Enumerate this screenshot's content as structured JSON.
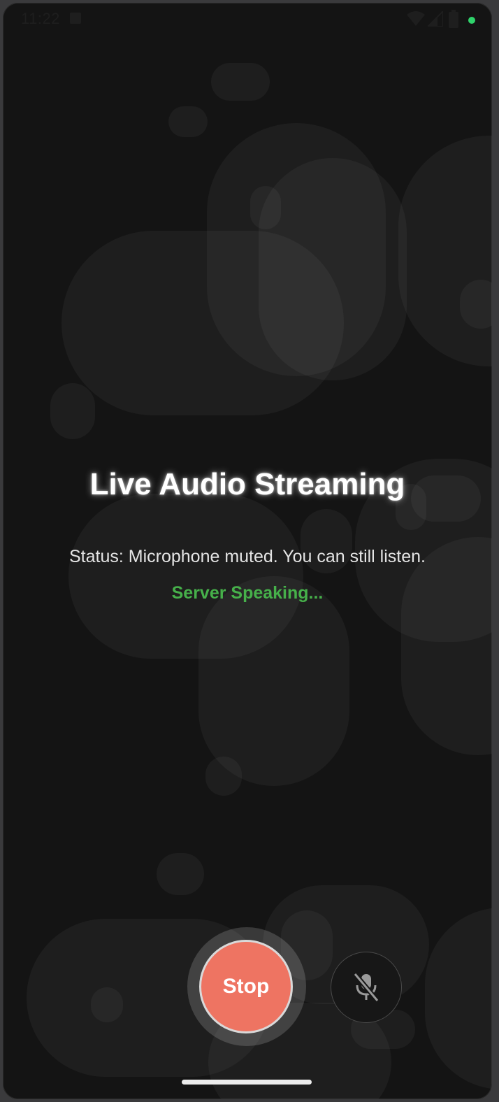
{
  "status_bar": {
    "time": "11:22",
    "icons": [
      "a-notification-icon",
      "wifi-icon",
      "signal-icon",
      "battery-icon",
      "green-dot-indicator"
    ],
    "indicator_color": "#2fd36b"
  },
  "main": {
    "title": "Live Audio Streaming",
    "status_text": "Status: Microphone muted. You can still listen.",
    "speaking_text": "Server Speaking..."
  },
  "controls": {
    "stop_label": "Stop",
    "mic_icon": "mic-off-icon"
  },
  "colors": {
    "background": "#141414",
    "stop_button": "#ee7462",
    "speaking": "#46b04a",
    "title": "#ffffff"
  }
}
